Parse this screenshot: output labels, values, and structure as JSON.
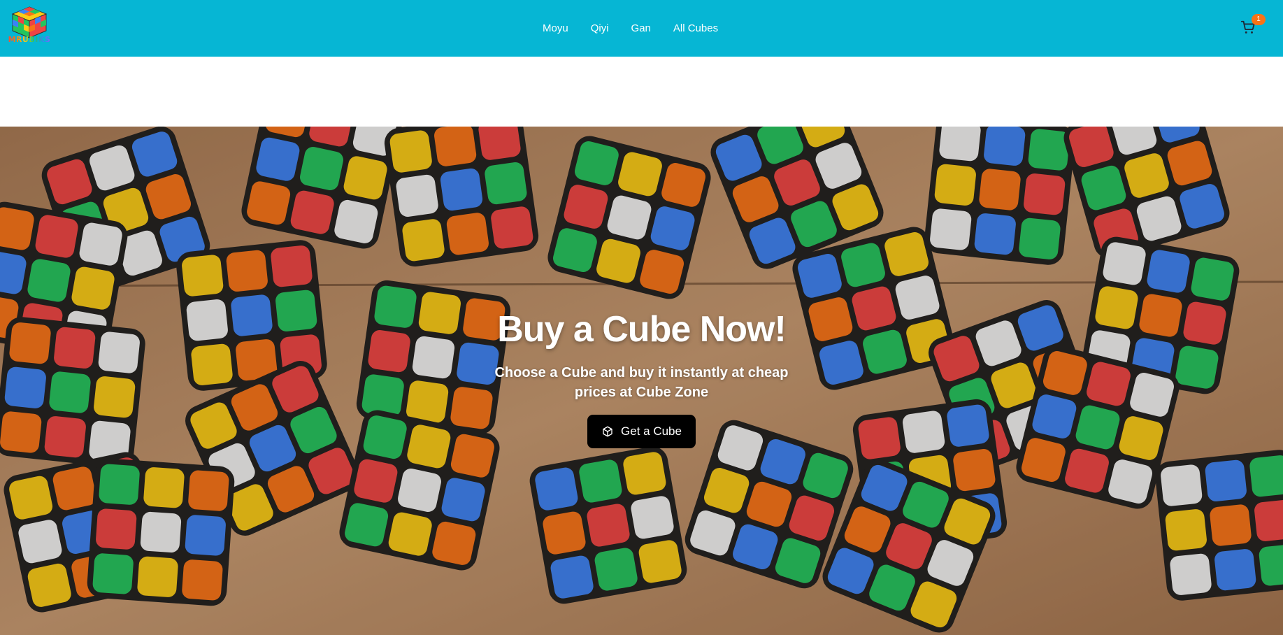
{
  "header": {
    "logo_text": "MRUBIKS",
    "nav": [
      {
        "label": "Moyu"
      },
      {
        "label": "Qiyi"
      },
      {
        "label": "Gan"
      },
      {
        "label": "All Cubes"
      }
    ],
    "cart_count": "1"
  },
  "hero": {
    "title": "Buy a Cube Now!",
    "subtitle": "Choose a Cube and buy it instantly at cheap prices at Cube Zone",
    "cta_label": "Get a Cube",
    "cta_icon": "cube-icon"
  },
  "colors": {
    "header_bg": "#06b6d4",
    "cta_bg": "#000000",
    "badge": "#f97316"
  }
}
